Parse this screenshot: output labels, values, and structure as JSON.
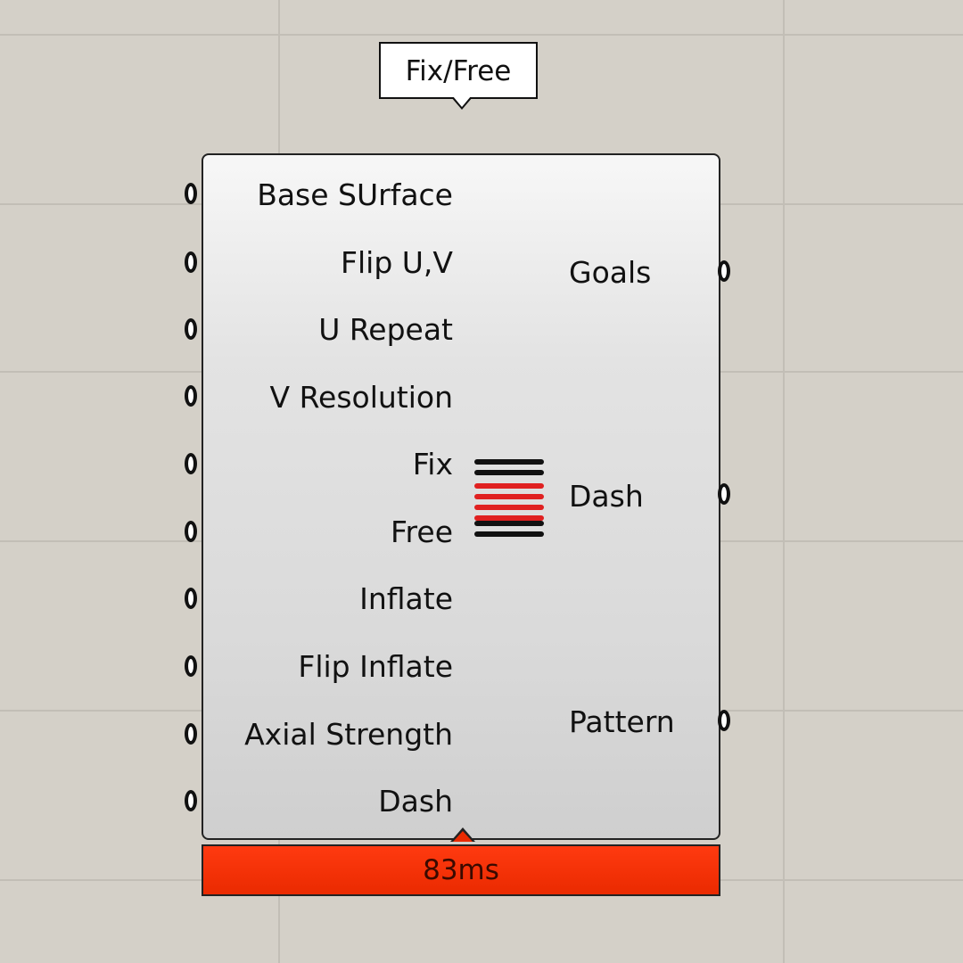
{
  "group_label": "Fix/Free",
  "component": {
    "inputs": [
      "Base SUrface",
      "Flip U,V",
      "U Repeat",
      "V Resolution",
      "Fix",
      "Free",
      "Inflate",
      "Flip Inflate",
      "Axial Strength",
      "Dash"
    ],
    "outputs": [
      "Goals",
      "Dash",
      "Pattern"
    ],
    "icon": "stacked-lines-icon",
    "icon_colors": [
      "#111111",
      "#111111",
      "#e02020",
      "#e02020",
      "#e02020",
      "#e02020",
      "#111111",
      "#111111"
    ]
  },
  "status": {
    "runtime": "83ms",
    "color": "#ea2a00"
  },
  "colors": {
    "canvas": "#d4d0c8",
    "grid": "#c2beb6",
    "component_fill": "#e0e0e0",
    "outline": "#222222"
  }
}
